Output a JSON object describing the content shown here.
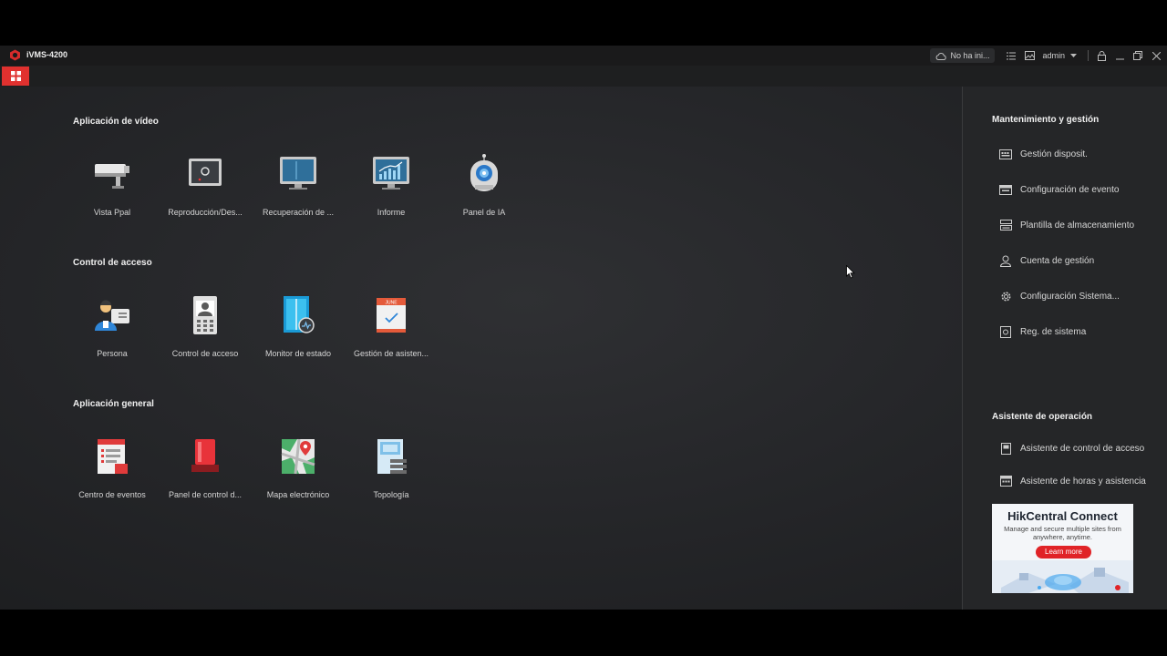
{
  "app": {
    "title": "iVMS-4200"
  },
  "titlebar": {
    "cloud_status": "No ha ini...",
    "user": "admin"
  },
  "sections": [
    {
      "title": "Aplicación de vídeo",
      "items": [
        {
          "label": "Vista Ppal",
          "icon": "camera-icon"
        },
        {
          "label": "Reproducción/Des...",
          "icon": "playback-icon"
        },
        {
          "label": "Recuperación de ...",
          "icon": "monitor-icon"
        },
        {
          "label": "Informe",
          "icon": "report-chart-icon"
        },
        {
          "label": "Panel de IA",
          "icon": "ai-robot-icon"
        }
      ]
    },
    {
      "title": "Control de acceso",
      "items": [
        {
          "label": "Persona",
          "icon": "person-icon"
        },
        {
          "label": "Control de acceso",
          "icon": "access-terminal-icon"
        },
        {
          "label": "Monitor de estado",
          "icon": "door-status-icon"
        },
        {
          "label": "Gestión de asisten...",
          "icon": "calendar-icon"
        }
      ]
    },
    {
      "title": "Aplicación general",
      "items": [
        {
          "label": "Centro de eventos",
          "icon": "event-center-icon"
        },
        {
          "label": "Panel de control d...",
          "icon": "alarm-light-icon"
        },
        {
          "label": "Mapa electrónico",
          "icon": "map-icon"
        },
        {
          "label": "Topología",
          "icon": "topology-icon"
        }
      ]
    }
  ],
  "sidebar": {
    "maintenance_title": "Mantenimiento y gestión",
    "maintenance_items": [
      {
        "label": "Gestión disposit.",
        "icon": "device-icon"
      },
      {
        "label": "Configuración de evento",
        "icon": "event-config-icon"
      },
      {
        "label": "Plantilla de almacenamiento",
        "icon": "storage-icon"
      },
      {
        "label": "Cuenta de gestión",
        "icon": "account-icon"
      },
      {
        "label": "Configuración Sistema...",
        "icon": "gear-icon"
      },
      {
        "label": "Reg. de sistema",
        "icon": "log-icon"
      }
    ],
    "wizard_title": "Asistente de operación",
    "wizard_items": [
      {
        "label": "Asistente de control de acceso",
        "icon": "access-wizard-icon"
      },
      {
        "label": "Asistente de horas y asistencia",
        "icon": "attendance-wizard-icon"
      }
    ]
  },
  "banner": {
    "title": "HikCentral Connect",
    "subtitle": "Manage and secure multiple sites from anywhere, anytime.",
    "cta": "Learn more"
  },
  "colors": {
    "accent": "#e0312f",
    "background": "#26272a",
    "sidebar": "#252628"
  }
}
